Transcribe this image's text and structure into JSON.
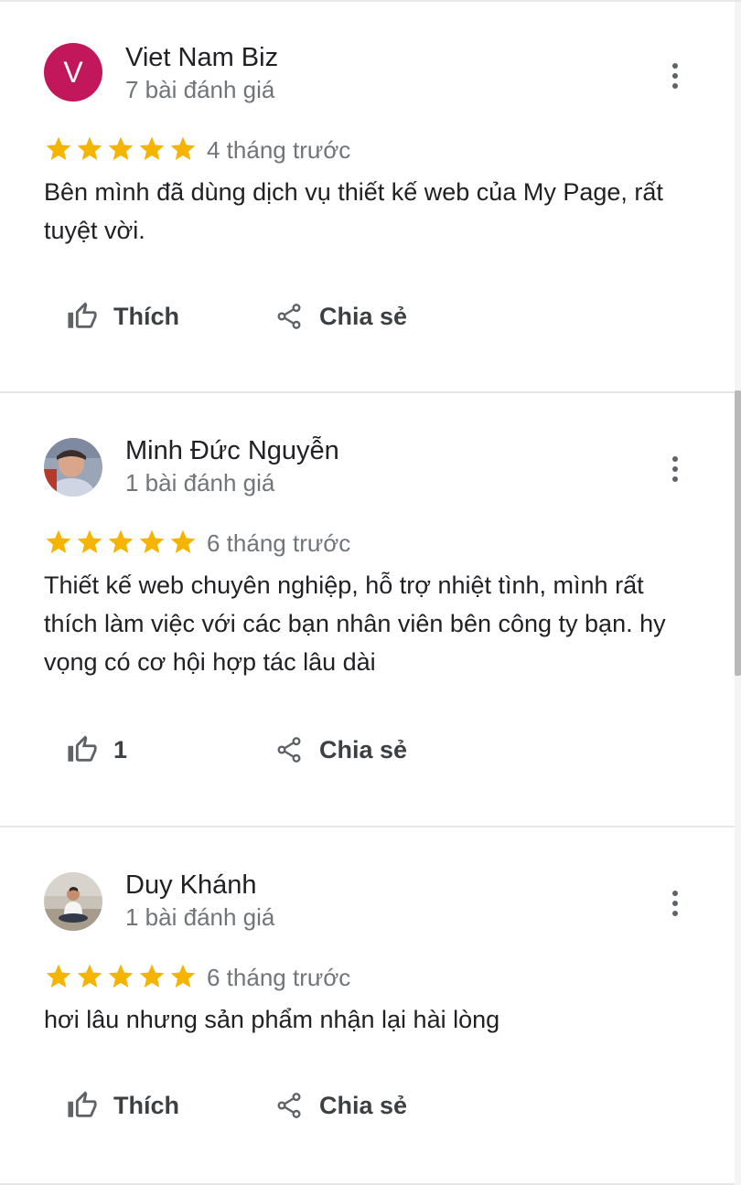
{
  "reviews": [
    {
      "avatar_letter": "V",
      "avatar_color": "#c2185b",
      "name": "Viet Nam Biz",
      "review_count": "7 bài đánh giá",
      "rating": 5,
      "time": "4 tháng trước",
      "text": "Bên mình đã dùng dịch vụ thiết kế web của My Page, rất tuyệt vời.",
      "like_label": "Thích",
      "share_label": "Chia sẻ"
    },
    {
      "avatar_letter": "",
      "name": "Minh Đức Nguyễn",
      "review_count": "1 bài đánh giá",
      "rating": 5,
      "time": "6 tháng trước",
      "text": "Thiết kế web chuyên nghiệp, hỗ trợ nhiệt tình, mình rất thích làm việc với các bạn nhân viên bên công ty bạn. hy vọng có cơ hội hợp tác lâu dài",
      "like_label": "1",
      "share_label": "Chia sẻ"
    },
    {
      "avatar_letter": "",
      "name": "Duy Khánh",
      "review_count": "1 bài đánh giá",
      "rating": 5,
      "time": "6 tháng trước",
      "text": "hơi lâu nhưng sản phẩm nhận lại hài lòng",
      "like_label": "Thích",
      "share_label": "Chia sẻ"
    }
  ],
  "colors": {
    "star": "#f4b400",
    "name": "#202124",
    "secondary_text": "#70757a",
    "action_text": "#3c4043",
    "icon": "#5f6368"
  },
  "icons": {
    "like": "thumb-up-outline-icon",
    "share": "share-icon",
    "more": "more-vert-icon",
    "star": "star-icon"
  }
}
